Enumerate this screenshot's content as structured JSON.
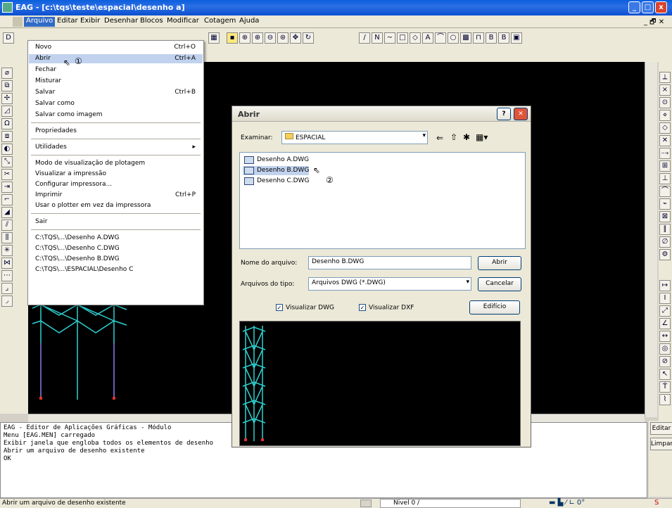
{
  "window": {
    "title": "EAG - [c:\\tqs\\teste\\espacial\\desenho a]"
  },
  "menubar": [
    "Arquivo",
    "Editar",
    "Exibir",
    "Desenhar",
    "Blocos",
    "Modificar",
    "Cotagem",
    "Ajuda"
  ],
  "file_menu": {
    "items": [
      {
        "label": "Novo",
        "shortcut": "Ctrl+O"
      },
      {
        "label": "Abrir",
        "shortcut": "Ctrl+A"
      },
      {
        "label": "Fechar",
        "shortcut": ""
      },
      {
        "label": "Misturar",
        "shortcut": ""
      },
      {
        "label": "Salvar",
        "shortcut": "Ctrl+B"
      },
      {
        "label": "Salvar como",
        "shortcut": ""
      },
      {
        "label": "Salvar como imagem",
        "shortcut": ""
      },
      {
        "label": "Propriedades",
        "shortcut": ""
      },
      {
        "label": "Utilidades",
        "shortcut": "▸"
      },
      {
        "label": "Modo de visualização de plotagem",
        "shortcut": ""
      },
      {
        "label": "Visualizar a impressão",
        "shortcut": ""
      },
      {
        "label": "Configurar impressora...",
        "shortcut": ""
      },
      {
        "label": "Imprimir",
        "shortcut": "Ctrl+P"
      },
      {
        "label": "Usar o plotter em vez da impressora",
        "shortcut": ""
      },
      {
        "label": "Sair",
        "shortcut": ""
      },
      {
        "label": "C:\\TQS\\...\\Desenho A.DWG",
        "shortcut": ""
      },
      {
        "label": "C:\\TQS\\...\\Desenho C.DWG",
        "shortcut": ""
      },
      {
        "label": "C:\\TQS\\...\\Desenho B.DWG",
        "shortcut": ""
      },
      {
        "label": "C:\\TQS\\...\\ESPACIAL\\Desenho C",
        "shortcut": ""
      }
    ]
  },
  "markers": [
    "①",
    "②"
  ],
  "dialog": {
    "title": "Abrir",
    "look_in_label": "Examinar:",
    "look_in_value": "ESPACIAL",
    "files": [
      "Desenho A.DWG",
      "Desenho B.DWG",
      "Desenho C.DWG"
    ],
    "filename_label": "Nome do arquivo:",
    "filename_value": "Desenho B.DWG",
    "filetype_label": "Arquivos do tipo:",
    "filetype_value": "Arquivos DWG (*.DWG)",
    "open_button": "Abrir",
    "cancel_button": "Cancelar",
    "building_button": "Edifício",
    "check_dwg": "Visualizar DWG",
    "check_dxf": "Visualizar DXF",
    "help_button": "?",
    "close_button": "✕"
  },
  "command_area": {
    "lines": [
      "EAG - Editor de Aplicações Gráficas - Módulo",
      "Menu [EAG.MEN] carregado",
      "Exibir janela que engloba todos os elementos de desenho",
      "Abrir um arquivo de desenho existente",
      "OK"
    ]
  },
  "side_buttons": [
    "Editar",
    "Limpar"
  ],
  "status": {
    "message": "Abrir um arquivo de desenho existente",
    "layer": "Nivel 0 /"
  }
}
